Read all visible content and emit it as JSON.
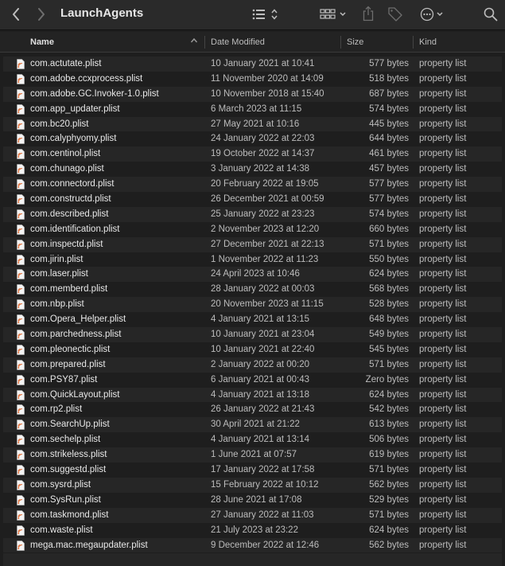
{
  "window": {
    "title": "LaunchAgents"
  },
  "toolbar": {
    "back_icon": "chevron-left-icon",
    "forward_icon": "chevron-right-icon",
    "view_icon": "list-view-icon",
    "group_icon": "grid-group-icon",
    "share_icon": "share-icon",
    "tag_icon": "tag-icon",
    "more_icon": "ellipsis-circle-icon",
    "search_icon": "search-icon"
  },
  "columns": {
    "name": "Name",
    "date": "Date Modified",
    "size": "Size",
    "kind": "Kind"
  },
  "files": [
    {
      "name": "com.actutate.plist",
      "date": "10 January 2021 at 10:41",
      "size": "577 bytes",
      "kind": "property list"
    },
    {
      "name": "com.adobe.ccxprocess.plist",
      "date": "11 November 2020 at 14:09",
      "size": "518 bytes",
      "kind": "property list"
    },
    {
      "name": "com.adobe.GC.Invoker-1.0.plist",
      "date": "10 November 2018 at 15:40",
      "size": "687 bytes",
      "kind": "property list"
    },
    {
      "name": "com.app_updater.plist",
      "date": "6 March 2023 at 11:15",
      "size": "574 bytes",
      "kind": "property list"
    },
    {
      "name": "com.bc20.plist",
      "date": "27 May 2021 at 10:16",
      "size": "445 bytes",
      "kind": "property list"
    },
    {
      "name": "com.calyphyomy.plist",
      "date": "24 January 2022 at 22:03",
      "size": "644 bytes",
      "kind": "property list"
    },
    {
      "name": "com.centinol.plist",
      "date": "19 October 2022 at 14:37",
      "size": "461 bytes",
      "kind": "property list"
    },
    {
      "name": "com.chunago.plist",
      "date": "3 January 2022 at 14:38",
      "size": "457 bytes",
      "kind": "property list"
    },
    {
      "name": "com.connectord.plist",
      "date": "20 February 2022 at 19:05",
      "size": "577 bytes",
      "kind": "property list"
    },
    {
      "name": "com.constructd.plist",
      "date": "26 December 2021 at 00:59",
      "size": "577 bytes",
      "kind": "property list"
    },
    {
      "name": "com.described.plist",
      "date": "25 January 2022 at 23:23",
      "size": "574 bytes",
      "kind": "property list"
    },
    {
      "name": "com.identification.plist",
      "date": "2 November 2023 at 12:20",
      "size": "660 bytes",
      "kind": "property list"
    },
    {
      "name": "com.inspectd.plist",
      "date": "27 December 2021 at 22:13",
      "size": "571 bytes",
      "kind": "property list"
    },
    {
      "name": "com.jirin.plist",
      "date": "1 November 2022 at 11:23",
      "size": "550 bytes",
      "kind": "property list"
    },
    {
      "name": "com.laser.plist",
      "date": "24 April 2023 at 10:46",
      "size": "624 bytes",
      "kind": "property list"
    },
    {
      "name": "com.memberd.plist",
      "date": "28 January 2022 at 00:03",
      "size": "568 bytes",
      "kind": "property list"
    },
    {
      "name": "com.nbp.plist",
      "date": "20 November 2023 at 11:15",
      "size": "528 bytes",
      "kind": "property list"
    },
    {
      "name": "com.Opera_Helper.plist",
      "date": "4 January 2021 at 13:15",
      "size": "648 bytes",
      "kind": "property list"
    },
    {
      "name": "com.parchedness.plist",
      "date": "10 January 2021 at 23:04",
      "size": "549 bytes",
      "kind": "property list"
    },
    {
      "name": "com.pleonectic.plist",
      "date": "10 January 2021 at 22:40",
      "size": "545 bytes",
      "kind": "property list"
    },
    {
      "name": "com.prepared.plist",
      "date": "2 January 2022 at 00:20",
      "size": "571 bytes",
      "kind": "property list"
    },
    {
      "name": "com.PSY87.plist",
      "date": "6 January 2021 at 00:43",
      "size": "Zero bytes",
      "kind": "property list"
    },
    {
      "name": "com.QuickLayout.plist",
      "date": "4 January 2021 at 13:18",
      "size": "624 bytes",
      "kind": "property list"
    },
    {
      "name": "com.rp2.plist",
      "date": "26 January 2022 at 21:43",
      "size": "542 bytes",
      "kind": "property list"
    },
    {
      "name": "com.SearchUp.plist",
      "date": "30 April 2021 at 21:22",
      "size": "613 bytes",
      "kind": "property list"
    },
    {
      "name": "com.sechelp.plist",
      "date": "4 January 2021 at 13:14",
      "size": "506 bytes",
      "kind": "property list"
    },
    {
      "name": "com.strikeless.plist",
      "date": "1 June 2021 at 07:57",
      "size": "619 bytes",
      "kind": "property list"
    },
    {
      "name": "com.suggestd.plist",
      "date": "17 January 2022 at 17:58",
      "size": "571 bytes",
      "kind": "property list"
    },
    {
      "name": "com.sysrd.plist",
      "date": "15 February 2022 at 10:12",
      "size": "562 bytes",
      "kind": "property list"
    },
    {
      "name": "com.SysRun.plist",
      "date": "28 June 2021 at 17:08",
      "size": "529 bytes",
      "kind": "property list"
    },
    {
      "name": "com.taskmond.plist",
      "date": "27 January 2022 at 11:03",
      "size": "571 bytes",
      "kind": "property list"
    },
    {
      "name": "com.waste.plist",
      "date": "21 July 2023 at 23:22",
      "size": "624 bytes",
      "kind": "property list"
    },
    {
      "name": "mega.mac.megaupdater.plist",
      "date": "9 December 2022 at 12:46",
      "size": "562 bytes",
      "kind": "property list"
    }
  ],
  "colors": {
    "background": "#1e1e1e",
    "row_alt": "#262626",
    "file_icon_accent": "#e0703a"
  }
}
